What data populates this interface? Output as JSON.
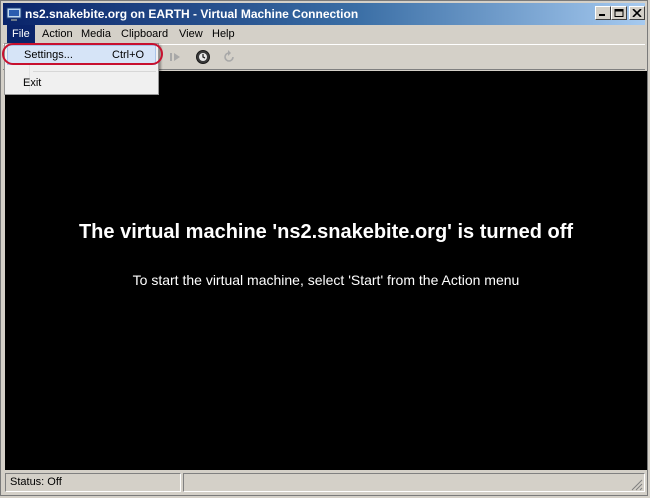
{
  "window": {
    "title": "ns2.snakebite.org on EARTH - Virtual Machine Connection"
  },
  "menu": {
    "items": [
      {
        "label": "File"
      },
      {
        "label": "Action"
      },
      {
        "label": "Media"
      },
      {
        "label": "Clipboard"
      },
      {
        "label": "View"
      },
      {
        "label": "Help"
      }
    ]
  },
  "file_menu": {
    "items": [
      {
        "label": "Settings...",
        "shortcut": "Ctrl+O"
      },
      {
        "label": "Exit"
      }
    ]
  },
  "screen": {
    "headline": "The virtual machine 'ns2.snakebite.org' is turned off",
    "hint": "To start the virtual machine, select 'Start' from the Action menu"
  },
  "status": {
    "text": "Status: Off"
  },
  "colors": {
    "titlebar": "#0a246a",
    "highlight_ring": "#c8102e",
    "screen_bg": "#000000"
  }
}
